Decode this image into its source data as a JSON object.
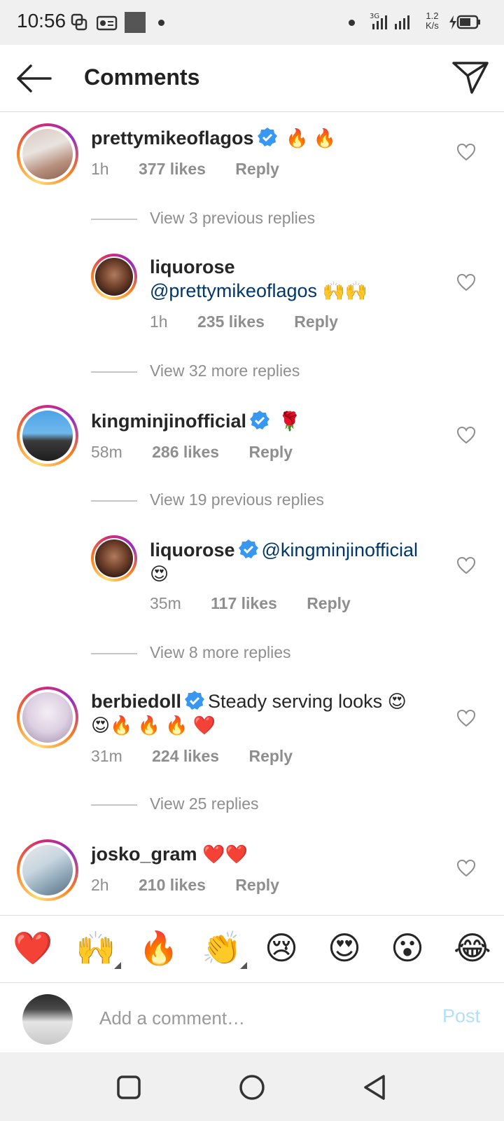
{
  "status_bar": {
    "time": "10:56",
    "net_speed_value": "1.2",
    "net_speed_unit": "K/s"
  },
  "header": {
    "title": "Comments"
  },
  "comments": [
    {
      "username": "prettymikeoflagos",
      "text": "",
      "emojis": "🔥 🔥",
      "time": "1h",
      "likes": "377 likes",
      "reply": "Reply",
      "view_replies": "View 3 previous replies"
    },
    {
      "username": "liquorose",
      "mention": "@prettymikeoflagos",
      "emojis": "🙌🙌",
      "time": "1h",
      "likes": "235 likes",
      "reply": "Reply",
      "view_replies": "View 32 more replies"
    },
    {
      "username": "kingminjinofficial",
      "emojis": "🌹",
      "time": "58m",
      "likes": "286 likes",
      "reply": "Reply",
      "view_replies": "View 19 previous replies"
    },
    {
      "username": "liquorose",
      "mention": "@kingminjinofficial",
      "emojis": "😍",
      "time": "35m",
      "likes": "117 likes",
      "reply": "Reply",
      "view_replies": "View 8 more replies"
    },
    {
      "username": "berbiedoll",
      "text": "Steady serving looks",
      "emojis_line1": "😍",
      "emojis_line2": "😍🔥 🔥 🔥 ❤️",
      "time": "31m",
      "likes": "224 likes",
      "reply": "Reply",
      "view_replies": "View 25 replies"
    },
    {
      "username": "josko_gram",
      "emojis": "❤️❤️",
      "time": "2h",
      "likes": "210 likes",
      "reply": "Reply"
    }
  ],
  "quick_emojis": [
    "❤️",
    "🙌",
    "🔥",
    "👏",
    "😢",
    "😍",
    "😮",
    "😂"
  ],
  "comment_input": {
    "placeholder": "Add a comment…",
    "post_label": "Post"
  },
  "colors": {
    "mention": "#00376b",
    "verified": "#3897f0",
    "post_disabled": "#b2dffc"
  }
}
